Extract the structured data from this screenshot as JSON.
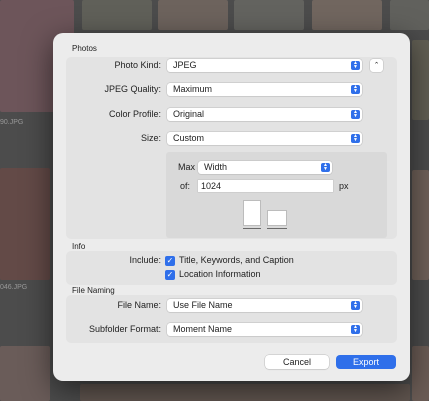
{
  "background": {
    "filenames": [
      "90.JPG",
      "046.JPG"
    ]
  },
  "dialog": {
    "sections": {
      "photos": "Photos",
      "info": "Info",
      "file_naming": "File Naming"
    },
    "photo_kind": {
      "label": "Photo Kind:",
      "value": "JPEG"
    },
    "jpeg_quality": {
      "label": "JPEG Quality:",
      "value": "Maximum"
    },
    "color_profile": {
      "label": "Color Profile:",
      "value": "Original"
    },
    "size": {
      "label": "Size:",
      "value": "Custom"
    },
    "max": {
      "label": "Max",
      "value": "Width"
    },
    "of": {
      "label": "of:",
      "value": "1024",
      "unit": "px"
    },
    "include": {
      "label": "Include:",
      "options": [
        {
          "label": "Title, Keywords, and Caption",
          "checked": true
        },
        {
          "label": "Location Information",
          "checked": true
        }
      ]
    },
    "file_name": {
      "label": "File Name:",
      "value": "Use File Name"
    },
    "subfolder_format": {
      "label": "Subfolder Format:",
      "value": "Moment Name"
    },
    "buttons": {
      "cancel": "Cancel",
      "export": "Export"
    }
  },
  "colors": {
    "accent": "#2f6fea",
    "panel": "#ececec",
    "group": "#e3e3e3"
  },
  "icons": {
    "popup_indicator": "chevron-up-down-icon",
    "collapse": "chevron-up-icon",
    "checkbox": "checkmark-icon"
  }
}
